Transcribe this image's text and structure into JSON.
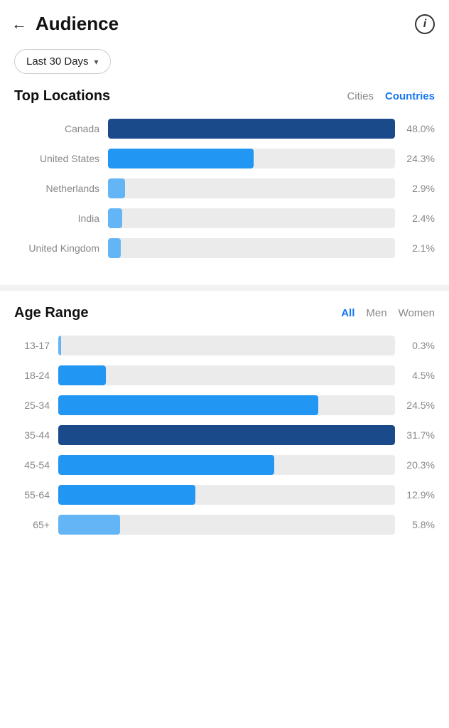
{
  "header": {
    "title": "Audience",
    "back_label": "←",
    "info_label": "i"
  },
  "date_filter": {
    "label": "Last 30 Days",
    "chevron": "▾"
  },
  "top_locations": {
    "title": "Top Locations",
    "tabs": [
      {
        "id": "cities",
        "label": "Cities",
        "active": false
      },
      {
        "id": "countries",
        "label": "Countries",
        "active": true
      }
    ],
    "rows": [
      {
        "name": "Canada",
        "percent": "48.0%",
        "value": 48.0,
        "color": "dark-blue"
      },
      {
        "name": "United States",
        "percent": "24.3%",
        "value": 24.3,
        "color": "medium-blue"
      },
      {
        "name": "Netherlands",
        "percent": "2.9%",
        "value": 2.9,
        "color": "light-blue"
      },
      {
        "name": "India",
        "percent": "2.4%",
        "value": 2.4,
        "color": "light-blue"
      },
      {
        "name": "United Kingdom",
        "percent": "2.1%",
        "value": 2.1,
        "color": "light-blue"
      }
    ]
  },
  "age_range": {
    "title": "Age Range",
    "tabs": [
      {
        "id": "all",
        "label": "All",
        "active": true
      },
      {
        "id": "men",
        "label": "Men",
        "active": false
      },
      {
        "id": "women",
        "label": "Women",
        "active": false
      }
    ],
    "rows": [
      {
        "label": "13-17",
        "percent": "0.3%",
        "value": 0.3,
        "color": "blue3"
      },
      {
        "label": "18-24",
        "percent": "4.5%",
        "value": 4.5,
        "color": "blue2"
      },
      {
        "label": "25-34",
        "percent": "24.5%",
        "value": 24.5,
        "color": "blue2"
      },
      {
        "label": "35-44",
        "percent": "31.7%",
        "value": 31.7,
        "color": "blue1"
      },
      {
        "label": "45-54",
        "percent": "20.3%",
        "value": 20.3,
        "color": "blue2"
      },
      {
        "label": "55-64",
        "percent": "12.9%",
        "value": 12.9,
        "color": "blue2"
      },
      {
        "label": "65+",
        "percent": "5.8%",
        "value": 5.8,
        "color": "blue3"
      }
    ],
    "max_value": 31.7
  }
}
